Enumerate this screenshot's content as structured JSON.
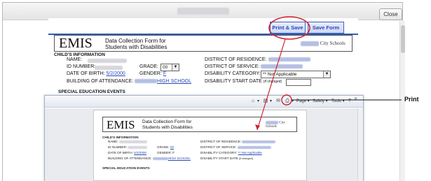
{
  "window": {
    "close_label": "Close"
  },
  "form": {
    "print_save_label": "Print & Save",
    "save_form_label": "Save Form",
    "logo": "EMIS",
    "subtitle_line1": "Data Collection Form for",
    "subtitle_line2": "Students with Disabilities",
    "district_suffix": "City Schools",
    "child_info_heading": "CHILD'S INFORMATION",
    "name_label": "NAME:",
    "id_label": "ID NUMBER:",
    "grade_label": "GRADE:",
    "grade_value": "00",
    "dob_label": "DATE OF BIRTH:",
    "dob_value": "5/2/2000",
    "gender_label": "GENDER:",
    "gender_value": "F",
    "building_label": "BUILDING OF ATTENDANCE:",
    "building_value": "HIGH SCHOOL",
    "residence_label": "DISTRICT OF RESIDENCE:",
    "service_label": "DISTRICT OF SERVICE:",
    "category_label": "DISABILITY CATEGORY:",
    "category_value": "** Not Applicable",
    "start_date_label": "DISABILITY START DATE",
    "start_date_note": "(if changed)",
    "sped_heading": "SPECIAL EDUCATION EVENTS"
  },
  "preview": {
    "toolbar": {
      "page_label": "Page",
      "safety_label": "Safety",
      "tools_label": "Tools"
    },
    "logo": "EMIS",
    "subtitle_line1": "Data Collection Form for",
    "subtitle_line2": "Students with Disabilities",
    "district_suffix": "City Schools",
    "child_info_heading": "CHILD'S INFORMATION",
    "name_label": "NAME:",
    "id_label": "ID NUMBER:",
    "grade_label": "GRADE:",
    "grade_value": "00",
    "dob_label": "DATE OF BIRTH:",
    "dob_value": "5/2/2000",
    "gender_label": "GENDER:",
    "gender_value": "F",
    "building_label": "BUILDING OF ATTENDANCE:",
    "building_value": "HIGH SCHOOL",
    "residence_label": "DISTRICT OF RESIDENCE:",
    "service_label": "DISTRICT OF SERVICE:",
    "category_label": "DISABILITY CATEGORY:",
    "category_value": "** Not Applicable",
    "start_date_label": "DISABILITY START DATE",
    "start_date_note": "(if changed)",
    "sped_heading": "SPECIAL EDUCATION EVENTS"
  },
  "annotation": {
    "print_label": "Print",
    "color": "#d0232f"
  }
}
